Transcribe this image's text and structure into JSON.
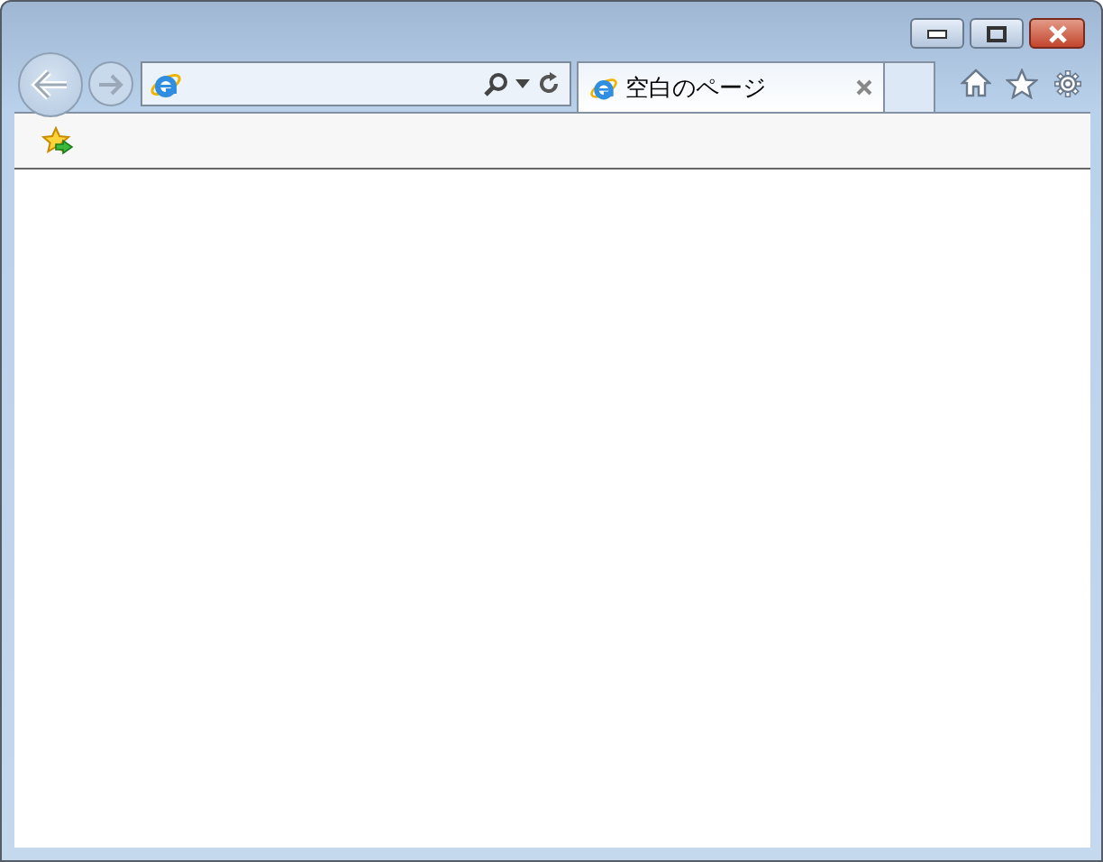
{
  "tabs": [
    {
      "label": "空白のページ",
      "selected": true
    }
  ]
}
